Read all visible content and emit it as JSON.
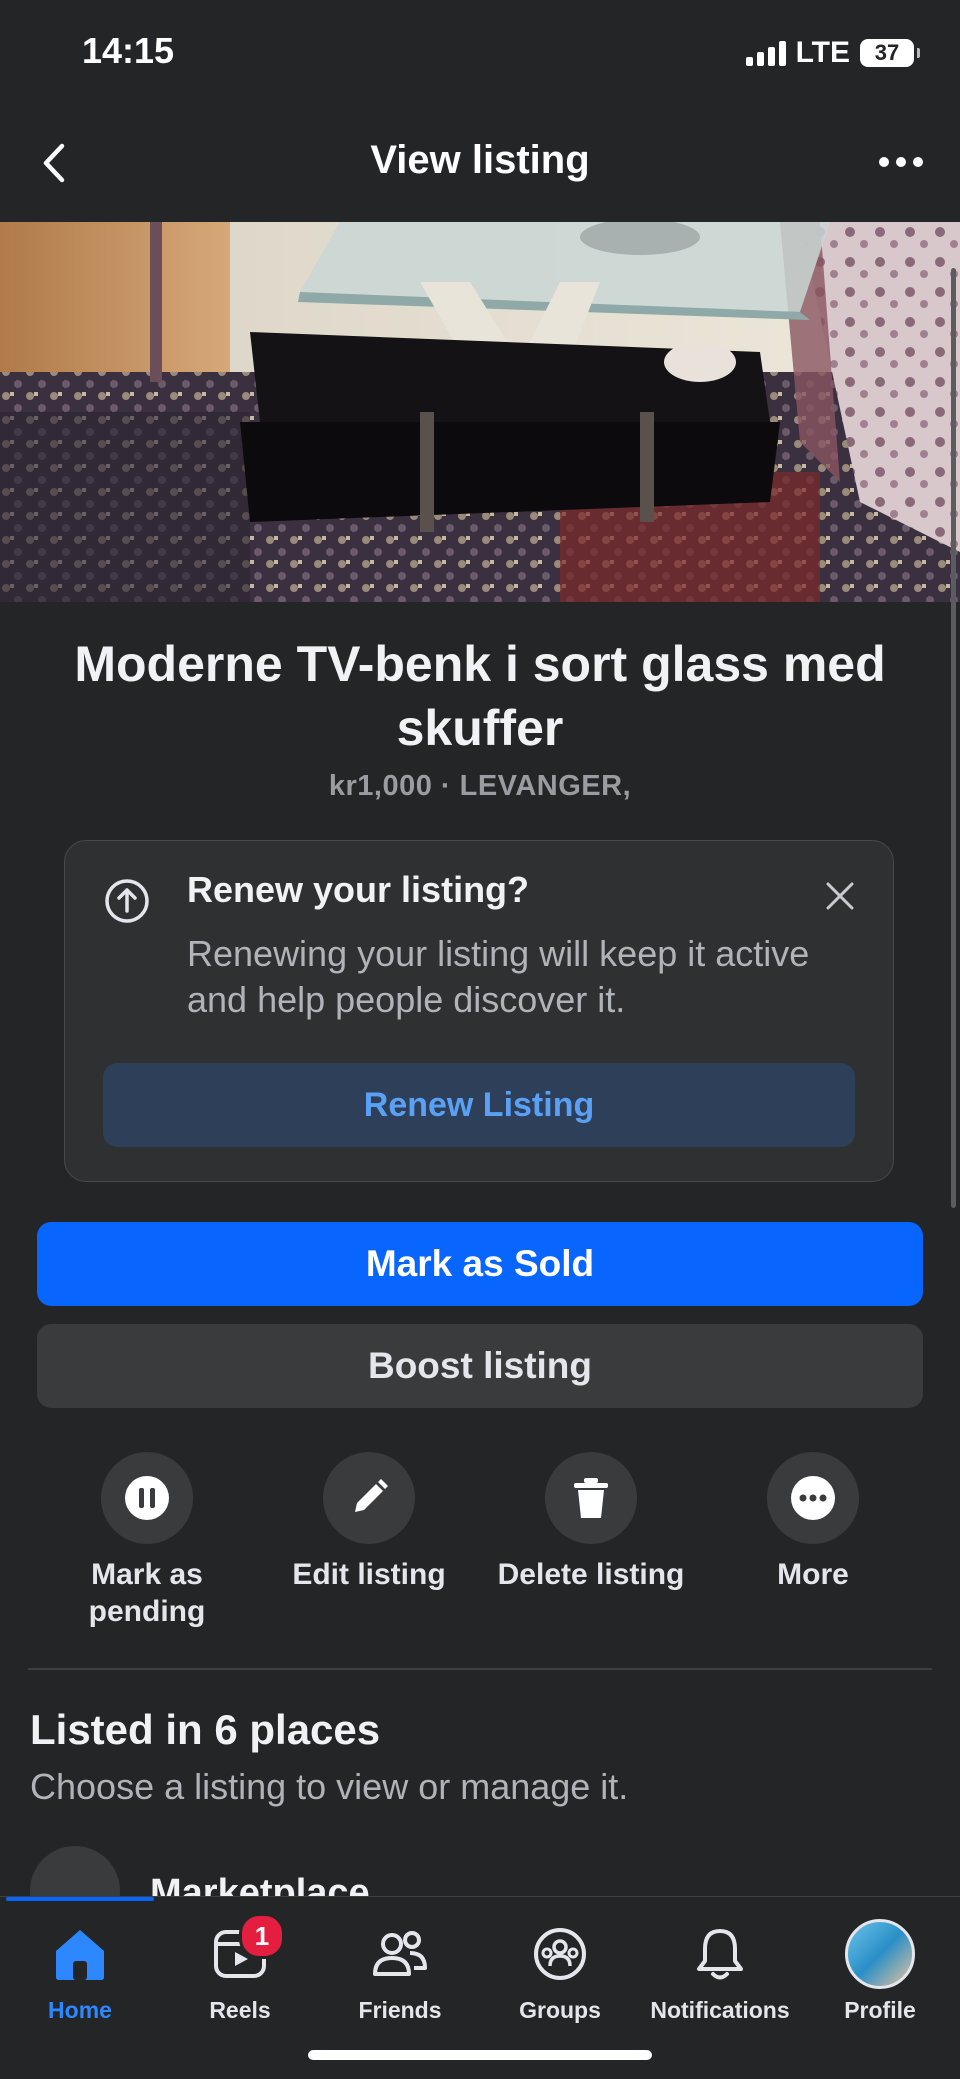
{
  "status_bar": {
    "time": "14:15",
    "network": "LTE",
    "battery": "37"
  },
  "header": {
    "title": "View listing",
    "back_icon": "chevron-left-icon",
    "more_icon": "more-horizontal-icon"
  },
  "listing": {
    "title": "Moderne TV-benk i sort glass med skuffer",
    "meta": "kr1,000 · LEVANGER,"
  },
  "renew_card": {
    "title": "Renew your listing?",
    "description": "Renewing your listing will keep it active and help people discover it.",
    "button_label": "Renew Listing",
    "icon": "arrow-up-circle-icon",
    "close_icon": "close-icon"
  },
  "buttons": {
    "mark_sold": "Mark as Sold",
    "boost": "Boost listing"
  },
  "actions": [
    {
      "label": "Mark as pending",
      "icon": "pause-icon"
    },
    {
      "label": "Edit listing",
      "icon": "pencil-icon"
    },
    {
      "label": "Delete listing",
      "icon": "trash-icon"
    },
    {
      "label": "More",
      "icon": "more-horizontal-icon"
    }
  ],
  "places": {
    "title": "Listed in 6 places",
    "subtitle": "Choose a listing to view or manage it.",
    "first_item": "Marketplace"
  },
  "tabbar": {
    "items": [
      {
        "label": "Home",
        "icon": "home-icon",
        "active": true
      },
      {
        "label": "Reels",
        "icon": "reels-icon",
        "badge": "1"
      },
      {
        "label": "Friends",
        "icon": "friends-icon"
      },
      {
        "label": "Groups",
        "icon": "groups-icon"
      },
      {
        "label": "Notifications",
        "icon": "bell-icon"
      },
      {
        "label": "Profile",
        "icon": "profile-avatar"
      }
    ]
  },
  "colors": {
    "accent": "#0866ff",
    "background": "#242526",
    "badge": "#e41e3f"
  }
}
